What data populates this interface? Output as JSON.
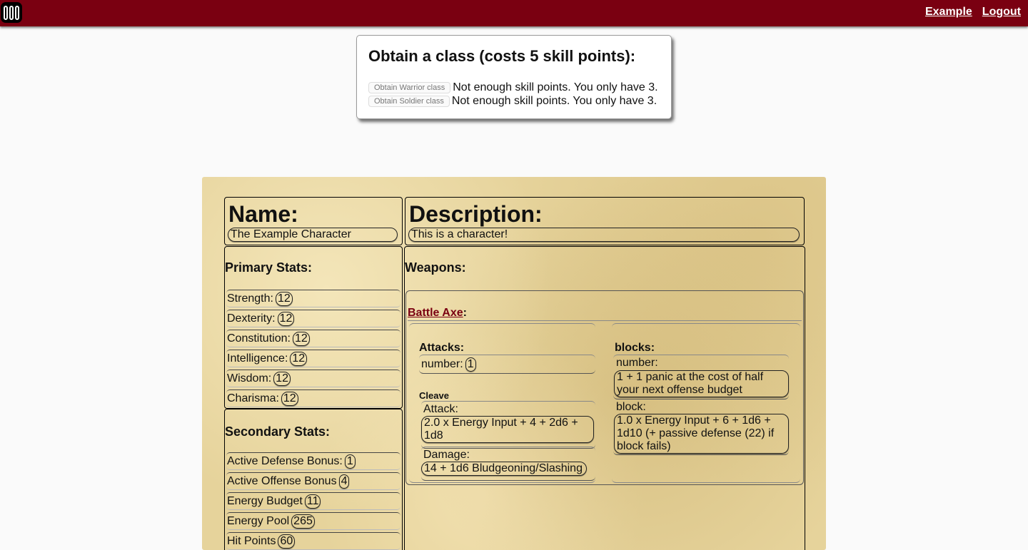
{
  "nav": {
    "user": "Example",
    "logout": "Logout"
  },
  "modal": {
    "title": "Obtain a class (costs 5 skill points):",
    "rows": [
      {
        "button": "Obtain Warrior class",
        "message": "Not enough skill points. You only have 3."
      },
      {
        "button": "Obtain Soldier class",
        "message": "Not enough skill points. You only have 3."
      }
    ]
  },
  "sheet": {
    "name_label": "Name:",
    "name_value": "The Example Character",
    "desc_label": "Description:",
    "desc_value": "This is a character!",
    "primary_title": "Primary Stats:",
    "primary": [
      {
        "label": "Strength:",
        "value": "12"
      },
      {
        "label": "Dexterity:",
        "value": "12"
      },
      {
        "label": "Constitution:",
        "value": "12"
      },
      {
        "label": "Intelligence:",
        "value": "12"
      },
      {
        "label": "Wisdom:",
        "value": "12"
      },
      {
        "label": "Charisma:",
        "value": "12"
      }
    ],
    "secondary_title": "Secondary Stats:",
    "secondary": [
      {
        "label": "Active Defense Bonus:",
        "value": "1"
      },
      {
        "label": "Active Offense Bonus",
        "value": "4"
      },
      {
        "label": "Energy Budget",
        "value": "11"
      },
      {
        "label": "Energy Pool",
        "value": "265"
      },
      {
        "label": "Hit Points",
        "value": "60"
      }
    ],
    "weapons_title": "Weapons:",
    "weapon": {
      "name": "Battle Axe",
      "colon": ":",
      "attacks_title": "Attacks:",
      "attacks_number_label": "number:",
      "attacks_number_value": "1",
      "attack_name": "Cleave",
      "attack_label": "Attack:",
      "attack_value": "2.0 x Energy Input + 4 + 2d6 + 1d8",
      "damage_label": "Damage:",
      "damage_value": "14 + 1d6 Bludgeoning/Slashing",
      "blocks_title": "blocks:",
      "blocks_number_label": "number:",
      "blocks_number_value": "1 + 1 panic at the cost of half your next offense budget",
      "block_label": "block:",
      "block_value": "1.0 x Energy Input + 6 + 1d6 + 1d10 (+ passive defense (22) if block fails)"
    }
  }
}
